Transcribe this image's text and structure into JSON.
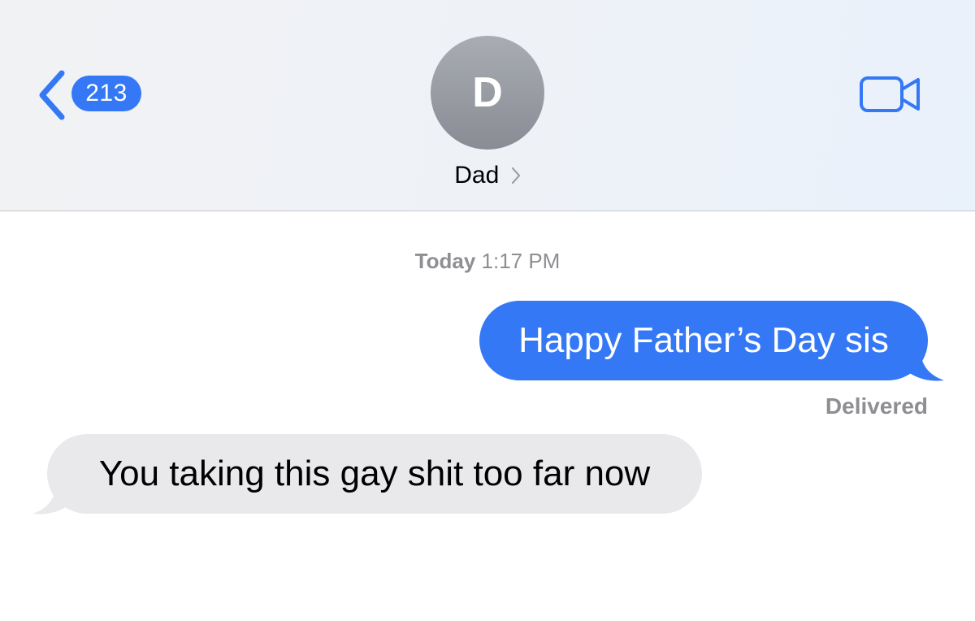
{
  "header": {
    "back_badge": "213",
    "avatar_initial": "D",
    "contact_name": "Dad"
  },
  "conversation": {
    "timestamp_day": "Today",
    "timestamp_time": "1:17 PM",
    "messages": [
      {
        "direction": "sent",
        "text": "Happy Father’s Day sis"
      },
      {
        "direction": "received",
        "text": "You taking this gay shit too far now"
      }
    ],
    "delivery_status": "Delivered"
  },
  "icons": {
    "back": "chevron-left-icon",
    "contact_details": "chevron-right-icon",
    "video": "video-camera-icon"
  },
  "colors": {
    "accent": "#3478f6",
    "sent_bubble": "#3478f6",
    "received_bubble": "#e9e9eb",
    "secondary_text": "#8e8e93",
    "avatar": "#9a9da4"
  }
}
